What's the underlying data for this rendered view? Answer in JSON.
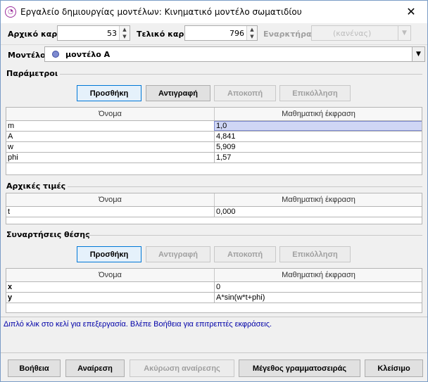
{
  "window": {
    "title": "Εργαλείο δημιουργίας μοντέλων: Κινηματικό μοντέλο σωματιδίου",
    "close_glyph": "✕"
  },
  "frames": {
    "start_label": "Αρχικό καρέ",
    "start_value": "53",
    "end_label": "Τελικό καρέ",
    "end_value": "796",
    "starter_label": "Εναρκτήρας",
    "starter_value": "(κανένας)"
  },
  "model": {
    "label": "Μοντέλο:",
    "value": "μοντέλο Α",
    "color": "#7e8bd0"
  },
  "parameters": {
    "title": "Παράμετροι",
    "buttons": {
      "add": "Προσθήκη",
      "copy": "Αντιγραφή",
      "cut": "Αποκοπή",
      "paste": "Επικόλληση"
    },
    "columns": [
      "Όνομα",
      "Μαθηματική έκφραση"
    ],
    "rows": [
      {
        "name": "m",
        "expr": "1,0"
      },
      {
        "name": "A",
        "expr": "4,841"
      },
      {
        "name": "w",
        "expr": "5,909"
      },
      {
        "name": "phi",
        "expr": "1,57"
      }
    ]
  },
  "initial": {
    "title": "Αρχικές τιμές",
    "columns": [
      "Όνομα",
      "Μαθηματική έκφραση"
    ],
    "rows": [
      {
        "name": "t",
        "expr": "0,000"
      }
    ]
  },
  "position": {
    "title": "Συναρτήσεις θέσης",
    "buttons": {
      "add": "Προσθήκη",
      "copy": "Αντιγραφή",
      "cut": "Αποκοπή",
      "paste": "Επικόλληση"
    },
    "columns": [
      "Όνομα",
      "Μαθηματική έκφραση"
    ],
    "rows": [
      {
        "name": "x",
        "expr": "0"
      },
      {
        "name": "y",
        "expr": "A*sin(w*t+phi)"
      }
    ]
  },
  "status": "Διπλό κλικ στο κελί για επεξεργασία. Βλέπε Βοήθεια για επιτρεπτές εκφράσεις.",
  "footer": {
    "help": "Βοήθεια",
    "undo": "Αναίρεση",
    "redo": "Ακύρωση αναίρεσης",
    "font": "Μέγεθος γραμματοσειράς",
    "close": "Κλείσιμο"
  }
}
